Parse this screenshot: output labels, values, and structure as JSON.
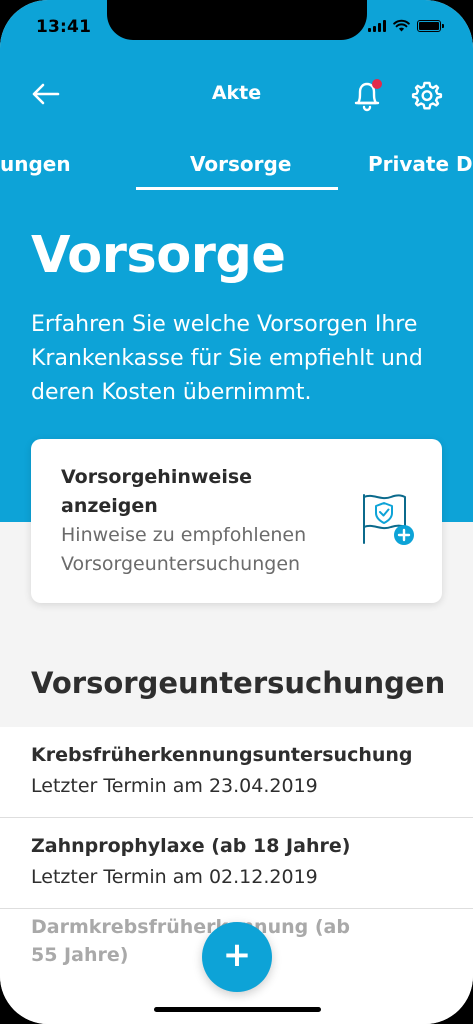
{
  "status_bar": {
    "time": "13:41"
  },
  "header": {
    "title": "Akte"
  },
  "tabs": [
    {
      "label": "ungen"
    },
    {
      "label": "Vorsorge"
    },
    {
      "label": "Private Do"
    }
  ],
  "hero": {
    "title": "Vorsorge",
    "subtitle": "Erfahren Sie welche Vorsorgen Ihre Krankenkasse für Sie empfiehlt und deren Kosten übernimmt."
  },
  "card": {
    "title": "Vorsorgehinweise anzeigen",
    "subtitle": "Hinweise zu empfohlenen Vorsorgeuntersuchungen"
  },
  "section": {
    "title": "Vorsorgeuntersuchungen"
  },
  "list": [
    {
      "title": "Krebsfrüherkennungsuntersuchung",
      "subtitle": "Letzter Termin am 23.04.2019"
    },
    {
      "title": "Zahnprophylaxe (ab 18 Jahre)",
      "subtitle": "Letzter Termin am 02.12.2019"
    },
    {
      "title": "Darmkrebsfrüherkennung (ab 55 Jahre)",
      "subtitle": ""
    }
  ],
  "fab": {
    "label": "+"
  },
  "colors": {
    "accent": "#0da3d7",
    "badge": "#e22a4b"
  }
}
